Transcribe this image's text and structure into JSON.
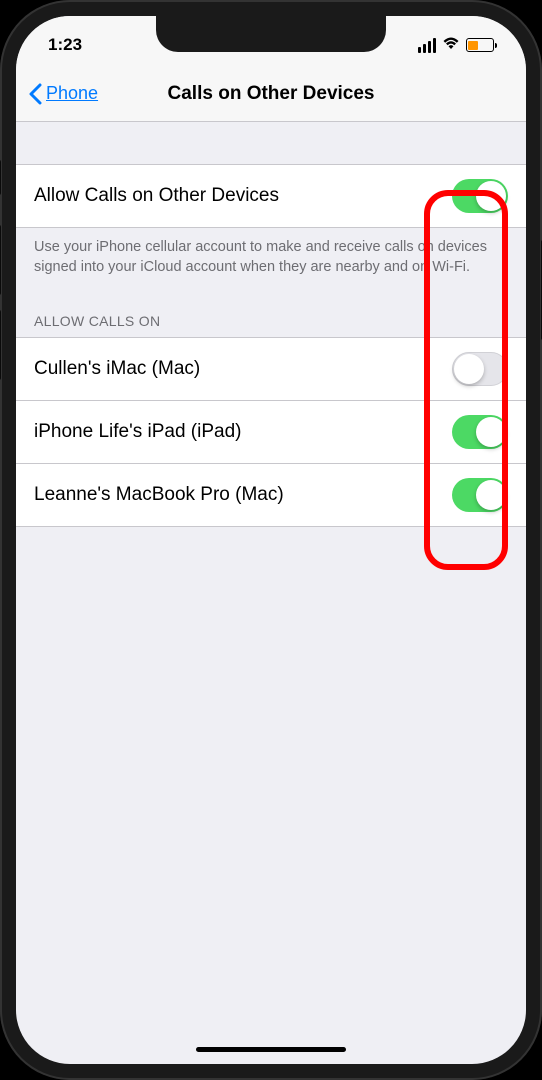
{
  "status": {
    "time": "1:23"
  },
  "nav": {
    "back_label": "Phone",
    "title": "Calls on Other Devices"
  },
  "main_toggle": {
    "label": "Allow Calls on Other Devices",
    "on": true
  },
  "footer": "Use your iPhone cellular account to make and receive calls on devices signed into your iCloud account when they are nearby and on Wi-Fi.",
  "section_header": "ALLOW CALLS ON",
  "devices": [
    {
      "label": "Cullen's iMac (Mac)",
      "on": false
    },
    {
      "label": "iPhone Life's iPad (iPad)",
      "on": true
    },
    {
      "label": "Leanne's MacBook Pro (Mac)",
      "on": true
    }
  ]
}
